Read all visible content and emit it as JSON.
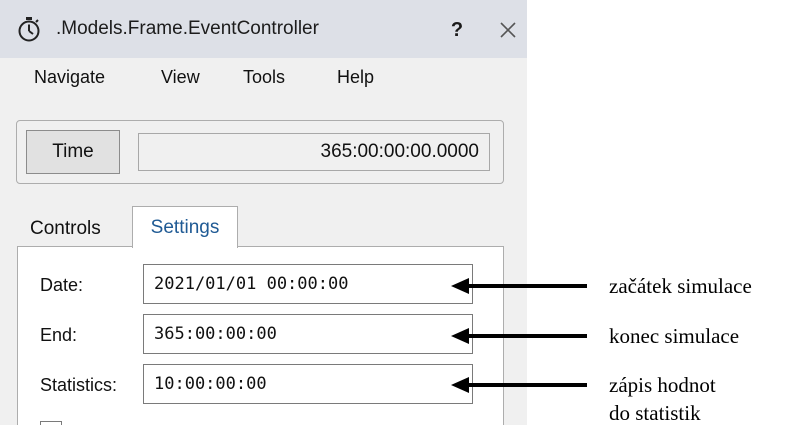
{
  "window": {
    "title": ".Models.Frame.EventController",
    "help_label": "?",
    "icons": {
      "app": "stopwatch-icon",
      "close": "close-icon"
    }
  },
  "menubar": {
    "items": [
      {
        "label": "Navigate"
      },
      {
        "label": "View"
      },
      {
        "label": "Tools"
      },
      {
        "label": "Help"
      }
    ]
  },
  "time": {
    "button_label": "Time",
    "value": "365:00:00:00.0000"
  },
  "tabs": [
    {
      "label": "Controls",
      "active": false
    },
    {
      "label": "Settings",
      "active": true
    }
  ],
  "settings": {
    "fields": [
      {
        "label": "Date:",
        "value": "2021/01/01 00:00:00"
      },
      {
        "label": "End:",
        "value": "365:00:00:00"
      },
      {
        "label": "Statistics:",
        "value": "10:00:00:00"
      }
    ]
  },
  "annotations": [
    {
      "text": "začátek simulace"
    },
    {
      "text": "konec simulace"
    },
    {
      "text": "zápis hodnot"
    },
    {
      "text": "do statistik"
    }
  ],
  "colors": {
    "titlebar": "#dde0e7",
    "window_bg": "#f0f0f0",
    "active_tab_text": "#1f5a94"
  }
}
